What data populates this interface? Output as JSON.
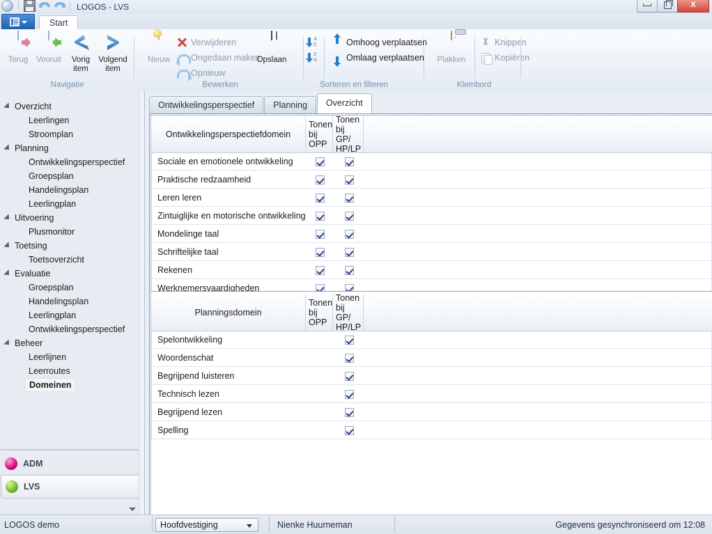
{
  "window": {
    "title": "LOGOS - LVS",
    "quick_access": [
      "app-globe-icon",
      "save-icon",
      "undo-icon",
      "redo-icon"
    ],
    "buttons": {
      "minimize": "minimize-icon",
      "restore": "restore-icon",
      "close": "X"
    }
  },
  "ribbon": {
    "app_button_label": "",
    "tabs": [
      {
        "label": "Start",
        "active": true
      }
    ],
    "groups": [
      {
        "label": "Navigatie",
        "big_buttons": [
          {
            "label": "Terug",
            "icon": "back-window-icon",
            "enabled": false
          },
          {
            "label": "Vooruit",
            "icon": "forward-window-icon",
            "enabled": false
          },
          {
            "label": "Vorig item",
            "icon": "chevron-left-icon",
            "enabled": true
          },
          {
            "label": "Volgend item",
            "icon": "chevron-right-icon",
            "enabled": true
          }
        ]
      },
      {
        "label": "Bewerken",
        "big_buttons": [
          {
            "label": "Nieuw",
            "icon": "new-document-icon",
            "enabled": false
          }
        ],
        "small_buttons": [
          {
            "label": "Verwijderen",
            "icon": "delete-x-icon",
            "enabled": false
          },
          {
            "label": "Ongedaan maken",
            "icon": "undo-arrow-icon",
            "enabled": false
          },
          {
            "label": "Opnieuw",
            "icon": "redo-arrow-icon",
            "enabled": false
          }
        ],
        "save_button": {
          "label": "Opslaan",
          "icon": "floppy-save-icon",
          "enabled": true
        }
      },
      {
        "label": "Sorteren en filteren",
        "sort_buttons": [
          {
            "icon": "sort-az-icon",
            "letters_top": "A",
            "letters_bottom": "Z",
            "enabled": false
          },
          {
            "icon": "sort-za-icon",
            "letters_top": "Z",
            "letters_bottom": "A",
            "enabled": false
          }
        ],
        "move_buttons": [
          {
            "label": "Omhoog verplaatsen",
            "icon": "arrow-up-icon",
            "enabled": true
          },
          {
            "label": "Omlaag verplaatsen",
            "icon": "arrow-down-icon",
            "enabled": true
          }
        ]
      },
      {
        "label": "Klembord",
        "big_buttons": [
          {
            "label": "Plakken",
            "icon": "clipboard-paste-icon",
            "enabled": false
          }
        ],
        "small_buttons": [
          {
            "label": "Knippen",
            "icon": "scissors-cut-icon",
            "enabled": false
          },
          {
            "label": "Kopiëren",
            "icon": "copy-icon",
            "enabled": false
          }
        ]
      }
    ]
  },
  "sidebar": {
    "tree": [
      {
        "label": "Overzicht",
        "level": "root",
        "expanded": true
      },
      {
        "label": "Leerlingen",
        "level": "child"
      },
      {
        "label": "Stroomplan",
        "level": "child"
      },
      {
        "label": "Planning",
        "level": "root",
        "expanded": true
      },
      {
        "label": "Ontwikkelingsperspectief",
        "level": "child"
      },
      {
        "label": "Groepsplan",
        "level": "child"
      },
      {
        "label": "Handelingsplan",
        "level": "child"
      },
      {
        "label": "Leerlingplan",
        "level": "child"
      },
      {
        "label": "Uitvoering",
        "level": "root",
        "expanded": true
      },
      {
        "label": "Plusmonitor",
        "level": "child"
      },
      {
        "label": "Toetsing",
        "level": "root",
        "expanded": true
      },
      {
        "label": "Toetsoverzicht",
        "level": "child"
      },
      {
        "label": "Evaluatie",
        "level": "root",
        "expanded": true
      },
      {
        "label": "Groepsplan",
        "level": "child"
      },
      {
        "label": "Handelingsplan",
        "level": "child"
      },
      {
        "label": "Leerlingplan",
        "level": "child"
      },
      {
        "label": "Ontwikkelingsperspectief",
        "level": "child"
      },
      {
        "label": "Beheer",
        "level": "root",
        "expanded": true
      },
      {
        "label": "Leerlijnen",
        "level": "child"
      },
      {
        "label": "Leerroutes",
        "level": "child"
      },
      {
        "label": "Domeinen",
        "level": "child",
        "selected": true
      }
    ],
    "modules": [
      {
        "label": "ADM",
        "color": "#d6007f",
        "selected": false
      },
      {
        "label": "LVS",
        "color": "#6cb92b",
        "selected": true
      }
    ]
  },
  "content": {
    "tabs": [
      {
        "label": "Ontwikkelingsperspectief",
        "active": false
      },
      {
        "label": "Planning",
        "active": false
      },
      {
        "label": "Overzicht",
        "active": true
      }
    ],
    "grid1": {
      "columns": [
        "Ontwikkelingsperspectiefdomein",
        "Tonen bij OPP",
        "Tonen bij GP/HP/LP",
        ""
      ],
      "rows": [
        {
          "name": "Sociale en emotionele ontwikkeling",
          "opp": true,
          "gp": true
        },
        {
          "name": "Praktische redzaamheid",
          "opp": true,
          "gp": true
        },
        {
          "name": "Leren leren",
          "opp": true,
          "gp": true
        },
        {
          "name": "Zintuiglijke en motorische ontwikkeling",
          "opp": true,
          "gp": true
        },
        {
          "name": "Mondelinge taal",
          "opp": true,
          "gp": true
        },
        {
          "name": "Schriftelijke taal",
          "opp": true,
          "gp": true
        },
        {
          "name": "Rekenen",
          "opp": true,
          "gp": true
        },
        {
          "name": "Werknemersvaardigheden",
          "opp": true,
          "gp": true
        }
      ]
    },
    "grid2": {
      "columns": [
        "Planningsdomein",
        "Tonen bij OPP",
        "Tonen bij GP/HP/LP",
        ""
      ],
      "rows": [
        {
          "name": "Spelontwikkeling",
          "opp": null,
          "gp": true
        },
        {
          "name": "Woordenschat",
          "opp": null,
          "gp": true
        },
        {
          "name": "Begrijpend luisteren",
          "opp": null,
          "gp": true
        },
        {
          "name": "Technisch lezen",
          "opp": null,
          "gp": true
        },
        {
          "name": "Begrijpend lezen",
          "opp": null,
          "gp": true
        },
        {
          "name": "Spelling",
          "opp": null,
          "gp": true
        }
      ]
    }
  },
  "statusbar": {
    "left": "LOGOS demo",
    "location_combo": "Hoofdvestiging",
    "user": "Nienke Huurneman",
    "sync": "Gegevens gesynchroniseerd om 12:08"
  }
}
